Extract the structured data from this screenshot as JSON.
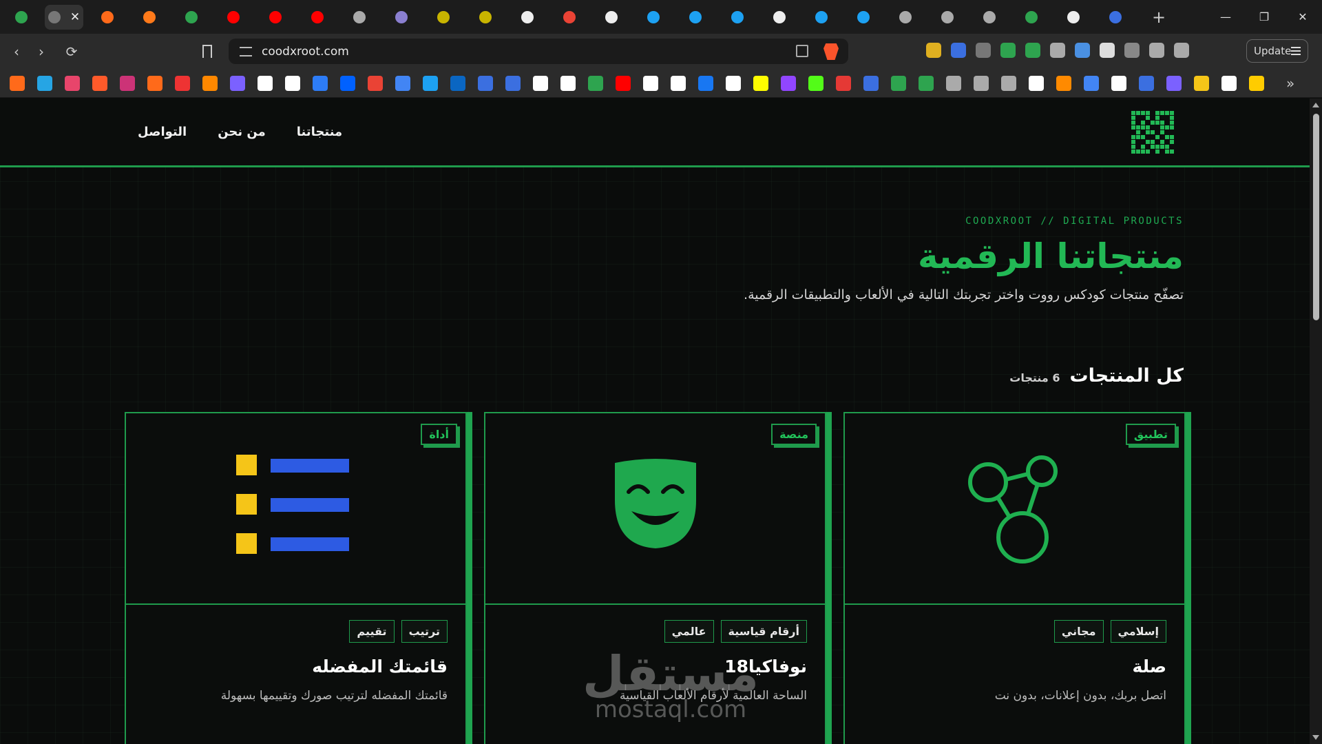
{
  "browser": {
    "tabs": [
      {
        "icon": "shield-green-icon",
        "color": "#2ea44f"
      },
      {
        "icon": "active-tab-icon",
        "color": "#777777",
        "active": true
      },
      {
        "icon": "orange-n-icon",
        "color": "#ff6a1a"
      },
      {
        "icon": "orange-link-icon",
        "color": "#ff7a1a"
      },
      {
        "icon": "green-triangle-icon",
        "color": "#2ea44f"
      },
      {
        "icon": "youtube-icon",
        "color": "#ff0000"
      },
      {
        "icon": "youtube-icon",
        "color": "#ff0000"
      },
      {
        "icon": "youtube-icon",
        "color": "#ff0000"
      },
      {
        "icon": "globe-icon",
        "color": "#aaaaaa"
      },
      {
        "icon": "gba-icon",
        "color": "#8a7fd0"
      },
      {
        "icon": "dot-icon",
        "color": "#c8b400"
      },
      {
        "icon": "dot-icon",
        "color": "#c8b400"
      },
      {
        "icon": "chatgpt-icon",
        "color": "#eeeeee"
      },
      {
        "icon": "gmail-icon",
        "color": "#ea4335"
      },
      {
        "icon": "google-icon",
        "color": "#eeeeee"
      },
      {
        "icon": "circle-blue-icon",
        "color": "#1da1f2"
      },
      {
        "icon": "circle-blue-icon",
        "color": "#1da1f2"
      },
      {
        "icon": "circle-blue-icon",
        "color": "#1da1f2"
      },
      {
        "icon": "google-icon",
        "color": "#eeeeee"
      },
      {
        "icon": "circle-blue-icon",
        "color": "#1da1f2"
      },
      {
        "icon": "circle-blue-icon",
        "color": "#1da1f2"
      },
      {
        "icon": "globe-icon",
        "color": "#aaaaaa"
      },
      {
        "icon": "globe-icon",
        "color": "#aaaaaa"
      },
      {
        "icon": "globe-icon",
        "color": "#aaaaaa"
      },
      {
        "icon": "green-8-icon",
        "color": "#2ea44f"
      },
      {
        "icon": "chatgpt-icon",
        "color": "#eeeeee"
      },
      {
        "icon": "blue-flag-icon",
        "color": "#3b6fe0"
      }
    ],
    "new_tab": "+",
    "window_controls": {
      "minimize": "—",
      "restore": "❐",
      "close": "✕"
    },
    "url": "coodxroot.com",
    "update_label": "Update",
    "extensions": [
      "#e0b020",
      "#3b6fe0",
      "#777777",
      "#2ea44f",
      "#2ea44f",
      "#aaaaaa",
      "#4a90e2",
      "#dddddd",
      "#888888",
      "#aaaaaa",
      "#aaaaaa"
    ],
    "bookmarks": [
      "#ff6a1a",
      "#26a5e4",
      "#e8456b",
      "#ff5a2a",
      "#cc3377",
      "#ff6a1a",
      "#ee3333",
      "#ff8800",
      "#7b61ff",
      "#ffffff",
      "#ffffff",
      "#2d7cf6",
      "#0061ff",
      "#ea4335",
      "#4285f4",
      "#1da1f2",
      "#0a66c2",
      "#3b6fe0",
      "#3b6fe0",
      "#ffffff",
      "#ffffff",
      "#2ea44f",
      "#ff0000",
      "#ffffff",
      "#ffffff",
      "#1877f2",
      "#ffffff",
      "#fffc00",
      "#9146ff",
      "#53fc18",
      "#e53935",
      "#3b6fe0",
      "#2ea44f",
      "#2ea44f",
      "#aaaaaa",
      "#aaaaaa",
      "#aaaaaa",
      "#ffffff",
      "#ff8a00",
      "#4285f4",
      "#ffffff",
      "#3b6fe0",
      "#7b61ff",
      "#f5c518",
      "#ffffff",
      "#ffcc00"
    ],
    "bookmarks_more": "»"
  },
  "site": {
    "nav": {
      "products": "منتجاتنا",
      "about": "من نحن",
      "contact": "التواصل"
    },
    "kicker": "COODXROOT // DIGITAL PRODUCTS",
    "title": "منتجاتنا الرقمية",
    "subtitle": "تصفّح منتجات كودكس رووت واختر تجربتك التالية في الألعاب والتطبيقات الرقمية.",
    "section_title": "كل المنتجات",
    "section_count": "6 منتجات",
    "products": [
      {
        "badge": "تطبيق",
        "tags": [
          "إسلامي",
          "مجاني"
        ],
        "title": "صلة",
        "desc": "اتصل بربك، بدون إعلانات، بدون نت",
        "icon": "connection-nodes-icon"
      },
      {
        "badge": "منصة",
        "tags": [
          "أرقام قياسية",
          "عالمي"
        ],
        "title": "نوفاكيا18",
        "desc": "الساحة العالمية لأرقام الألعاب القياسية",
        "icon": "comedy-mask-icon"
      },
      {
        "badge": "أداة",
        "tags": [
          "ترتيب",
          "تقييم"
        ],
        "title": "قائمتك المفضله",
        "desc": "قائمتك المفضله لترتيب صورك وتقييمها بسهولة",
        "icon": "ranked-list-icon"
      }
    ],
    "colors": {
      "accent": "#22b855",
      "border": "#1f9b4c",
      "list_marker": "#f5c518",
      "list_bar": "#2d5be3"
    }
  },
  "watermark": {
    "arabic": "مستقل",
    "latin": "mostaql.com"
  }
}
